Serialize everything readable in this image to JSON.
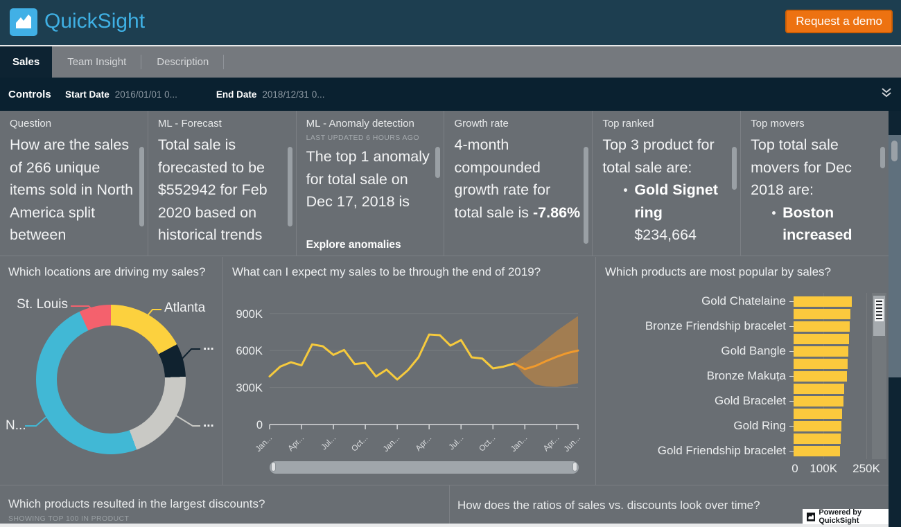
{
  "header": {
    "brand": "QuickSight",
    "cta_label": "Request a demo"
  },
  "tabs": [
    {
      "label": "Sales",
      "active": true
    },
    {
      "label": "Team Insight",
      "active": false
    },
    {
      "label": "Description",
      "active": false
    }
  ],
  "controls": {
    "title": "Controls",
    "fields": [
      {
        "label": "Start Date",
        "value": "2016/01/01 0..."
      },
      {
        "label": "End Date",
        "value": "2018/12/31 0..."
      }
    ]
  },
  "insights": [
    {
      "title": "Question",
      "body": [
        {
          "text": "How are the sales of 266 unique items sold in North America split between"
        }
      ]
    },
    {
      "title": "ML - Forecast",
      "body": [
        {
          "text": "Total sale is forecasted to be $552942 for Feb 2020 based on historical trends"
        }
      ]
    },
    {
      "title": "ML - Anomaly detection",
      "subtitle": "LAST UPDATED 6 HOURS AGO",
      "body": [
        {
          "text": "The top 1 anomaly for total sale on Dec 17, 2018 is"
        }
      ],
      "footer": "Explore anomalies"
    },
    {
      "title": "Growth rate",
      "body": [
        {
          "text": "4-month compounded growth rate for total sale is "
        },
        {
          "text": "-7.86%",
          "bold": true
        }
      ]
    },
    {
      "title": "Top ranked",
      "body": [
        {
          "text": "Top 3 product for total sale are:"
        }
      ],
      "bullets": [
        {
          "text": "Gold Signet ring",
          "bold": true,
          "sub": "$234,664"
        }
      ]
    },
    {
      "title": "Top movers",
      "body": [
        {
          "text": "Top total sale movers for Dec 2018 are:"
        }
      ],
      "bullets": [
        {
          "text": "Boston increased",
          "bold": true
        }
      ]
    }
  ],
  "chart_data": [
    {
      "type": "pie",
      "donut": true,
      "title": "Which locations are driving my sales?",
      "segments": [
        {
          "label": "Atlanta",
          "pct": 17.2,
          "color": "#fcd13e"
        },
        {
          "label": "...",
          "pct": 7.2,
          "color": "#10222f"
        },
        {
          "label": "...",
          "pct": 20.0,
          "color": "#c9c9c5"
        },
        {
          "label": "N...",
          "pct": 48.7,
          "color": "#41b8d5"
        },
        {
          "label": "St. Louis",
          "pct": 6.9,
          "color": "#f4616d"
        }
      ]
    },
    {
      "type": "line",
      "title": "What can I expect my sales to be through the end of 2019?",
      "y_tick_labels": [
        "900K",
        "600K",
        "300K",
        "0"
      ],
      "y_tick_values_k": [
        900,
        600,
        300,
        0
      ],
      "ylim_k": [
        0,
        950
      ],
      "x_tick_labels": [
        "Jan...",
        "Apr...",
        "Jul...",
        "Oct...",
        "Jan...",
        "Apr...",
        "Jul...",
        "Oct...",
        "Jan...",
        "Apr...",
        "Jun..."
      ],
      "x_tick_months": [
        0,
        3,
        6,
        9,
        12,
        15,
        18,
        21,
        24,
        27,
        29
      ],
      "series": [
        {
          "name": "historical",
          "color": "#f6ca3d",
          "start_month": 0,
          "values_k": [
            390,
            470,
            505,
            480,
            650,
            635,
            565,
            605,
            490,
            500,
            390,
            445,
            365,
            440,
            545,
            730,
            725,
            640,
            685,
            545,
            535,
            455,
            470,
            495
          ]
        },
        {
          "name": "forecast",
          "color": "#f09a2d",
          "start_month": 23,
          "values_k": [
            495,
            450,
            475,
            515,
            550,
            580,
            600
          ]
        }
      ],
      "band": {
        "start_month": 23,
        "color": "#b08148",
        "upper_k": [
          495,
          560,
          620,
          690,
          760,
          820,
          880
        ],
        "lower_k": [
          495,
          395,
          325,
          308,
          305,
          318,
          335
        ]
      }
    },
    {
      "type": "bar",
      "orientation": "horizontal",
      "title": "Which products are most popular by sales?",
      "categories": [
        "Gold Chatelaine",
        "",
        "Bronze Friendship bracelet",
        "",
        "Gold Bangle",
        "",
        "Bronze Makuṭa",
        "",
        "Gold Bracelet",
        "",
        "Gold Ring",
        "",
        "Gold Friendship bracelet"
      ],
      "values_k": [
        203,
        199,
        196,
        194,
        192,
        190,
        186,
        176,
        174,
        170,
        168,
        165,
        163
      ],
      "xlim_k": [
        0,
        250
      ],
      "x_tick_labels": [
        "0",
        "100K",
        "250K"
      ],
      "x_tick_values_k": [
        0,
        100,
        250
      ],
      "bar_color": "#fbc93d"
    }
  ],
  "bottom": {
    "panels": [
      {
        "title": "Which products resulted in the largest discounts?",
        "subtitle": "SHOWING TOP 100 IN PRODUCT"
      },
      {
        "title": "How does the ratios of sales vs. discounts look over time?"
      }
    ]
  },
  "badge": {
    "label": "Powered by QuickSight"
  },
  "colors": {
    "header_bg": "#1d3e50",
    "brand_blue": "#3fb0e4",
    "cta_orange": "#ed7211",
    "tabbar_bg": "#75797e",
    "active_tab_bg": "#0d2332",
    "controls_bg": "#0a2130",
    "content_bg": "#696e73",
    "divider": "#7b7f84",
    "hist_line": "#f6ca3d",
    "forecast_line": "#f09a2d",
    "forecast_band": "#b08148",
    "bar_yellow": "#fbc93d"
  }
}
